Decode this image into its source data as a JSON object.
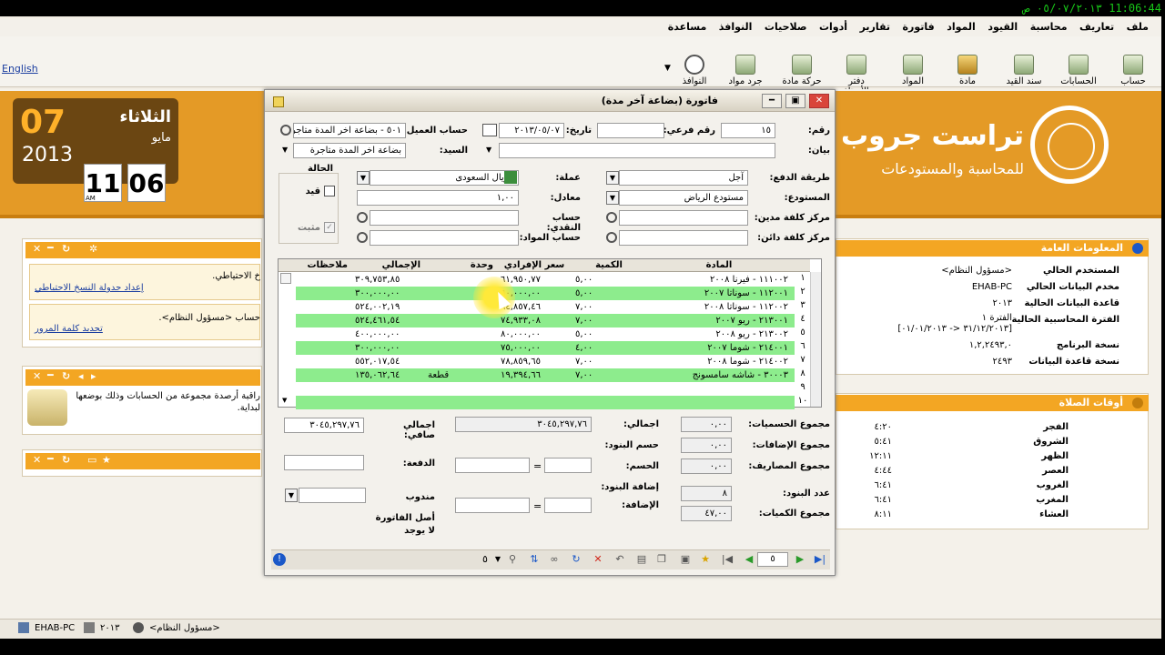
{
  "clock": "11:06:44 ٠٥/٠٧/٢٠١٣ ص",
  "menu": [
    "ملف",
    "تعاريف",
    "محاسبة",
    "القيود",
    "المواد",
    "فاتورة",
    "تقارير",
    "أدوات",
    "صلاحيات",
    "النوافذ",
    "مساعدة"
  ],
  "toolbar": [
    {
      "label": "حساب",
      "icon": "account-icon"
    },
    {
      "label": "الحسابات",
      "icon": "accounts-icon"
    },
    {
      "label": "سند القيد",
      "icon": "journal-voucher-icon"
    },
    {
      "label": "مادة",
      "icon": "item-icon"
    },
    {
      "label": "المواد",
      "icon": "items-icon"
    },
    {
      "label": "دفتر الأستاذ",
      "icon": "ledger-icon"
    },
    {
      "label": "حركة مادة",
      "icon": "item-movement-icon"
    },
    {
      "label": "جرد مواد",
      "icon": "inventory-icon"
    },
    {
      "label": "النوافذ",
      "icon": "windows-icon"
    }
  ],
  "english_link": "English",
  "date_widget": {
    "day": "07",
    "year": "2013",
    "day_name": "الثلاثاء",
    "month": "مايو",
    "hour": "11",
    "minute": "06",
    "am": "AM"
  },
  "logo": {
    "name": "تراست جروب",
    "subtitle": "للمحاسبة والمستودعات"
  },
  "left_panels": {
    "p1_text1": "خ الاحتياطي.",
    "p1_link1": "إعداد جدولة النسخ الاحتياطي",
    "p1_text2": "حساب <مسؤول النظام>.",
    "p1_link2": "تحديد كلمة المرور",
    "p2_text1": "راقبة أرصدة مجموعة من الحسابات وذلك بوضعها",
    "p2_text2": "لبداية."
  },
  "info_panel": {
    "title": "المعلومات العامة",
    "rows": [
      {
        "label": "المستخدم الحالي",
        "value": "<مسؤول النظام>"
      },
      {
        "label": "مخدم البيانات الحالي",
        "value": "EHAB-PC"
      },
      {
        "label": "قاعدة البيانات الحالية",
        "value": "٢٠١٣"
      },
      {
        "label": "الفترة المحاسبية الحالية",
        "value": "الفترة ١"
      },
      {
        "label": "",
        "value": "[٣١/١٢/٢٠١٣ <- ٠١/٠١/٢٠١٣]"
      },
      {
        "label": "نسخة البرنامج",
        "value": "١,٢,٢٤٩٣,٠"
      },
      {
        "label": "نسخة قاعدة البيانات",
        "value": "٢٤٩٣"
      }
    ]
  },
  "prayer_panel": {
    "title": "أوقات الصلاة",
    "rows": [
      {
        "name": "الفجر",
        "time": "٤:٢٠"
      },
      {
        "name": "الشروق",
        "time": "٥:٤١"
      },
      {
        "name": "الظهر",
        "time": "١٢:١١"
      },
      {
        "name": "العصر",
        "time": "٤:٤٤"
      },
      {
        "name": "الغروب",
        "time": "٦:٤١"
      },
      {
        "name": "المغرب",
        "time": "٦:٤١"
      },
      {
        "name": "العشاء",
        "time": "٨:١١"
      }
    ]
  },
  "dialog": {
    "title": "فاتورة (بضاعة آخر مدة)",
    "labels": {
      "number": "رقم:",
      "sub_number": "رقم فرعي:",
      "date": "تاريخ:",
      "customer_account": "حساب العميل:",
      "statement": "بيان:",
      "mister": "السيد:",
      "payment_method": "طريقة الدفع:",
      "currency": "عملة:",
      "status": "الحالة",
      "warehouse": "المستودع:",
      "rate": "معادل:",
      "cost_center_debit": "مركز كلفة مدين:",
      "cash_account": "حساب النقدي:",
      "cost_center_credit": "مركز كلفة دائن:",
      "items_account": "حساب المواد:",
      "draft": "قيد",
      "posted": "مثبت"
    },
    "values": {
      "number": "١٥",
      "sub_number": "",
      "date": "٢٠١٣/٠٥/٠٧",
      "customer_account": "٥٠١ - بضاعة اخر المدة متاجر",
      "statement": "",
      "mister": "بضاعة اخر المدة متاجرة",
      "payment_method": "آجل",
      "currency": "الريال السعودى",
      "warehouse": "مستودع الرياض",
      "rate": "١,٠٠"
    },
    "grid_headers": [
      "المادة",
      "الكمية",
      "سعر الإفرادي",
      "وحدة",
      "الإجمالي",
      "ملاحظات"
    ],
    "rows": [
      {
        "n": "١",
        "item": "١١١٠٠٢ - فيرنا ٢٠٠٨",
        "qty": "٥,٠٠",
        "price": "٦١,٩٥٠,٧٧",
        "unit": "",
        "total": "٣٠٩,٧٥٣,٨٥",
        "green": false
      },
      {
        "n": "٢",
        "item": "١١٢٠٠١ - سوناتا ٢٠٠٧",
        "qty": "٥,٠٠",
        "price": "٦٠,٠٠٠,٠٠",
        "unit": "",
        "total": "٣٠٠,٠٠٠,٠٠",
        "green": true
      },
      {
        "n": "٣",
        "item": "١١٢٠٠٢ - سوناتا ٢٠٠٨",
        "qty": "٧,٠٠",
        "price": "٦٤,٨٥٧,٤٦",
        "unit": "",
        "total": "٥٢٤,٠٠٢,١٩",
        "green": false
      },
      {
        "n": "٤",
        "item": "٢١٣٠٠١ - ريو ٢٠٠٧",
        "qty": "٧,٠٠",
        "price": "٧٤,٩٣٣,٠٨",
        "unit": "",
        "total": "٥٢٤,٤٦١,٥٤",
        "green": true
      },
      {
        "n": "٥",
        "item": "٢١٣٠٠٢ - ريو ٢٠٠٨",
        "qty": "٥,٠٠",
        "price": "٨٠,٠٠٠,٠٠",
        "unit": "",
        "total": "٤٠٠,٠٠٠,٠٠",
        "green": false
      },
      {
        "n": "٦",
        "item": "٢١٤٠٠١ - شوما ٢٠٠٧",
        "qty": "٤,٠٠",
        "price": "٧٥,٠٠٠,٠٠",
        "unit": "",
        "total": "٣٠٠,٠٠٠,٠٠",
        "green": true
      },
      {
        "n": "٧",
        "item": "٢١٤٠٠٢ - شوما ٢٠٠٨",
        "qty": "٧,٠٠",
        "price": "٧٨,٨٥٩,٦٥",
        "unit": "",
        "total": "٥٥٢,٠١٧,٥٤",
        "green": false
      },
      {
        "n": "٨",
        "item": "٣٠٠٠٣ - شاشه سامسونج",
        "qty": "٧,٠٠",
        "price": "١٩,٣٩٤,٦٦",
        "unit": "قطعة",
        "total": "١٣٥,٠٦٢,٦٤",
        "green": true
      },
      {
        "n": "٩",
        "item": "",
        "qty": "",
        "price": "",
        "unit": "",
        "total": "",
        "green": false
      },
      {
        "n": "١٠",
        "item": "",
        "qty": "",
        "price": "",
        "unit": "",
        "total": "",
        "green": true
      }
    ],
    "totals_labels": {
      "discounts_sum": "مجموع الحسميات:",
      "additions_sum": "مجموع الإضافات:",
      "expenses_sum": "مجموع المصاريف:",
      "items_count": "عدد البنود:",
      "qty_sum": "مجموع الكميات:",
      "total": "اجمالي:",
      "items_discount": "حسم البنود:",
      "discount": "الحسم:",
      "items_addition": "إضافة البنود:",
      "addition": "الإضافة:",
      "net_total": "اجمالي صافي:",
      "payment": "الدفعة:",
      "rep": "مندوب",
      "invoice_origin": "أصل الفاتورة"
    },
    "totals": {
      "discounts_sum": "٠,٠٠",
      "additions_sum": "٠,٠٠",
      "expenses_sum": "٠,٠٠",
      "items_count": "٨",
      "qty_sum": "٤٧,٠٠",
      "total": "٣٠٤٥,٢٩٧,٧٦",
      "net_total": "٣٠٤٥,٢٩٧,٧٦",
      "invoice_origin": "لا يوجد",
      "eq": "="
    },
    "nav": {
      "page": "٥",
      "count": "٥"
    }
  },
  "statusbar": {
    "server": "EHAB-PC",
    "db": "٢٠١٣",
    "user": "<مسؤول النظام>"
  }
}
